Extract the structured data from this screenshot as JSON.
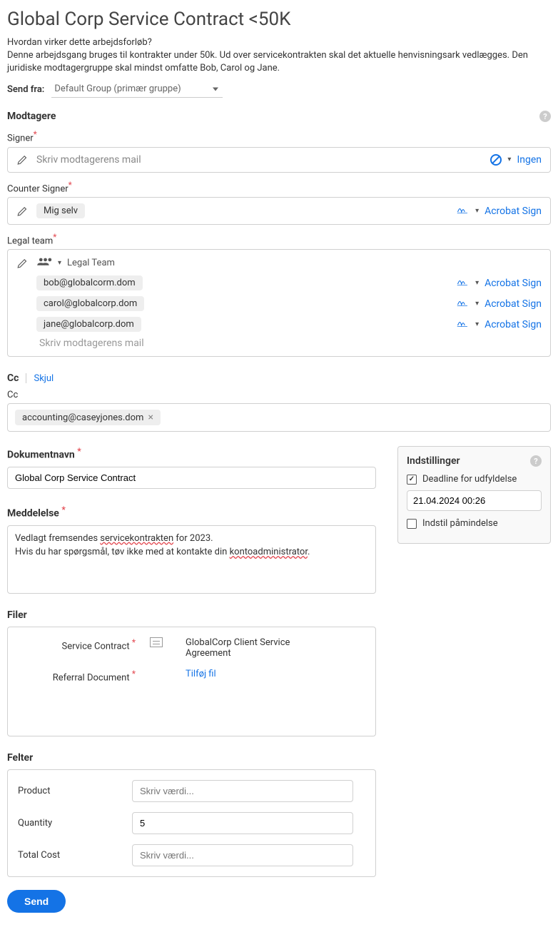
{
  "page_title": "Global Corp Service Contract <50K",
  "description_q": "Hvordan virker dette arbejdsforløb?",
  "description": "Denne arbejdsgang bruges til kontrakter under 50k. Ud over servicekontrakten skal det aktuelle henvisningsark vedlægges. Den juridiske modtagergruppe skal mindst omfatte Bob, Carol og Jane.",
  "send_from_label": "Send fra:",
  "send_from_value": "Default Group (primær gruppe)",
  "recipients": {
    "title": "Modtagere",
    "signer": {
      "label": "Signer",
      "placeholder": "Skriv modtagerens mail",
      "status": "Ingen"
    },
    "counter_signer": {
      "label": "Counter Signer",
      "chip": "Mig selv",
      "status": "Acrobat Sign"
    },
    "legal": {
      "label": "Legal team",
      "group_name": "Legal Team",
      "members": [
        {
          "email": "bob@globalcorm.dom",
          "status": "Acrobat Sign"
        },
        {
          "email": "carol@globalcorp.dom",
          "status": "Acrobat Sign"
        },
        {
          "email": "jane@globalcorp.dom",
          "status": "Acrobat Sign"
        }
      ],
      "placeholder": "Skriv modtagerens mail"
    }
  },
  "cc": {
    "label": "Cc",
    "hide": "Skjul",
    "field_label": "Cc",
    "chips": [
      "accounting@caseyjones.dom"
    ]
  },
  "doc_name": {
    "label": "Dokumentnavn",
    "value": "Global Corp Service Contract"
  },
  "message": {
    "label": "Meddelelse",
    "line1a": "Vedlagt fremsendes ",
    "line1b": "servicekontrakten",
    "line1c": " for 2023.",
    "line2a": "Hvis du har spørgsmål, tøv ikke med at kontakte din ",
    "line2b": "kontoadministrator",
    "line2c": "."
  },
  "settings": {
    "title": "Indstillinger",
    "deadline_label": "Deadline for udfyldelse",
    "deadline_value": "21.04.2024 00:26",
    "reminder_label": "Indstil påmindelse"
  },
  "files": {
    "title": "Filer",
    "rows": [
      {
        "label": "Service Contract",
        "required": true,
        "filename": "GlobalCorp Client Service Agreement"
      },
      {
        "label": "Referral Document",
        "required": true,
        "action": "Tilføj fil"
      }
    ]
  },
  "fields": {
    "title": "Felter",
    "product": {
      "label": "Product",
      "placeholder": "Skriv værdi..."
    },
    "quantity": {
      "label": "Quantity",
      "value": "5"
    },
    "total": {
      "label": "Total Cost",
      "placeholder": "Skriv værdi..."
    }
  },
  "send_button": "Send"
}
